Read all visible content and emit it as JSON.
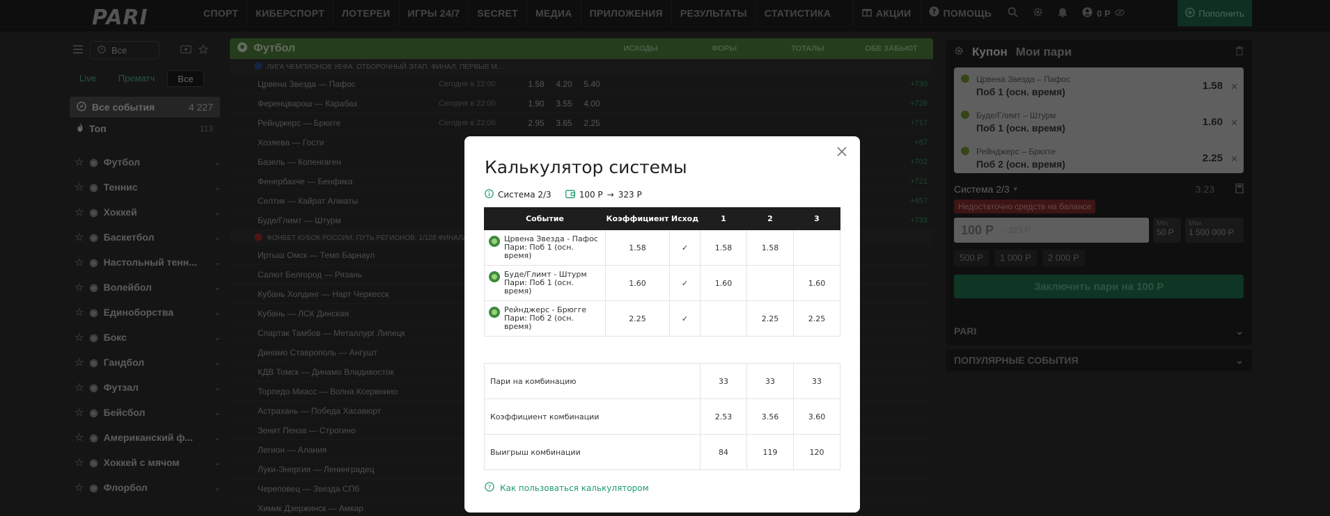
{
  "header": {
    "logo": "PARI",
    "nav": [
      "СПОРТ",
      "КИБЕРСПОРТ",
      "ЛОТЕРЕИ",
      "ИГРЫ 24/7",
      "SECRET",
      "МЕДИА",
      "ПРИЛОЖЕНИЯ",
      "РЕЗУЛЬТАТЫ",
      "СТАТИСТИКА"
    ],
    "promo": "АКЦИИ",
    "help": "ПОМОЩЬ",
    "balance": "0 Р",
    "deposit": "Пополнить"
  },
  "sidebar": {
    "filter": "Все",
    "segments": [
      "Live",
      "Прематч",
      "Все"
    ],
    "all_events": {
      "label": "Все события",
      "count": "4 227"
    },
    "top": {
      "label": "Топ",
      "count": "113"
    },
    "sports": [
      "Футбол",
      "Теннис",
      "Хоккей",
      "Баскетбол",
      "Настольный тенн...",
      "Волейбол",
      "Единоборства",
      "Бокс",
      "Гандбол",
      "Футзал",
      "Бейсбол",
      "Американский ф...",
      "Хоккей с мячом",
      "Флорбол"
    ]
  },
  "main": {
    "sport": "Футбол",
    "groups": [
      "ИСХОДЫ",
      "ФОРЫ",
      "ТОТАЛЫ",
      "ОБЕ ЗАБЬЮТ"
    ],
    "league1": "ЛИГА ЧЕМПИОНОВ УЕФА. ОТБОРОЧНЫЙ ЭТАП. ФИНАЛ. ПЕРВЫЕ М...",
    "rows1": [
      {
        "teams": "Црвена Звезда — Пафос",
        "date": "Сегодня в 22:00",
        "o1": "1.58",
        "ox": "4.20",
        "o2": "5.40",
        "more": "+730"
      },
      {
        "teams": "Ференцварош — Карабах",
        "date": "Сегодня в 22:00",
        "o1": "1.90",
        "ox": "3.55",
        "o2": "4.00",
        "more": "+726"
      },
      {
        "teams": "Рейнджерс — Брюгге",
        "date": "Сегодня в 22:00",
        "o1": "2.95",
        "ox": "3.65",
        "o2": "2.25",
        "more": "+717"
      },
      {
        "teams": "Хозяева — Гости",
        "date": "",
        "o1": "",
        "ox": "",
        "o2": "",
        "more": "+87"
      },
      {
        "teams": "Базель — Копенгаген",
        "date": "",
        "o1": "",
        "ox": "",
        "o2": "",
        "more": "+702"
      },
      {
        "teams": "Фенербахче — Бенфика",
        "date": "",
        "o1": "",
        "ox": "",
        "o2": "",
        "more": "+721"
      },
      {
        "teams": "Селтик — Кайрат Алматы",
        "date": "",
        "o1": "",
        "ox": "",
        "o2": "",
        "more": "+657"
      },
      {
        "teams": "Буде/Глимт — Штурм",
        "date": "",
        "o1": "",
        "ox": "",
        "o2": "",
        "more": "+733"
      }
    ],
    "league2": "ФОНБЕТ КУБОК РОССИИ. ПУТЬ РЕГИОНОВ. 1/128 ФИНАЛА",
    "rows2": [
      "Иртыш Омск — Темп Барнаул",
      "Салют Белгород — Рязань",
      "Кубань Холдинг — Нарт Черкесск",
      "Кубань — ЛСК Динская",
      "Спартак Тамбов — Металлург Липецк",
      "Динамо Ставрополь — Ангушт",
      "КДВ Томск — Динамо Владивосток",
      "Торпедо Миасс — Волна Ксервнино",
      "Астрахань — Победа Хасавюрт",
      "Зенит Пенза — Строгино",
      "Легион — Алания",
      "Луки-Энергия — Ленинградец",
      "Череповец — Звезда СПб",
      "Химик Дзержинск — Амкар"
    ]
  },
  "coupon": {
    "title": "Купон",
    "my": "Мои пари",
    "bets": [
      {
        "teams": "Црвена Звезда – Пафос",
        "outcome": "Поб 1 (осн. время)",
        "odd": "1.58"
      },
      {
        "teams": "Буде/Глимт – Штурм",
        "outcome": "Поб 1 (осн. время)",
        "odd": "1.60"
      },
      {
        "teams": "Рейнджерс – Брюгге",
        "outcome": "Поб 2 (осн. время)",
        "odd": "2.25"
      }
    ],
    "system": "Система 2/3",
    "coef": "3.23",
    "warning": "Недостаточно средств на балансе",
    "amount": "100 Р",
    "amount_to": "→ 323 Р",
    "min_label": "Min",
    "min_value": "50 Р",
    "max_label": "Max",
    "max_value": "1 500 000 Р",
    "quick": [
      "500 Р",
      "1 000 Р",
      "2 000 Р"
    ],
    "submit": "Заключить пари на 100 Р",
    "acc1": "PARI",
    "acc2": "ПОПУЛЯРНЫЕ СОБЫТИЯ"
  },
  "modal": {
    "title": "Калькулятор системы",
    "system": "Система 2/3",
    "stake": "100 Р",
    "arrow": "→",
    "payout": "323 Р",
    "headers": [
      "Событие",
      "Коэффициент",
      "Исход",
      "1",
      "2",
      "3"
    ],
    "events": [
      {
        "name": "Црвена Звезда - Пафос Пари: Поб 1 (осн. время)",
        "coef": "1.58",
        "check": "✓",
        "c1": "1.58",
        "c2": "1.58",
        "c3": ""
      },
      {
        "name": "Буде/Глимт - Штурм Пари: Поб 1 (осн. время)",
        "coef": "1.60",
        "check": "✓",
        "c1": "1.60",
        "c2": "",
        "c3": "1.60"
      },
      {
        "name": "Рейнджерс - Брюгге Пари: Поб 2 (осн. время)",
        "coef": "2.25",
        "check": "✓",
        "c1": "",
        "c2": "2.25",
        "c3": "2.25"
      }
    ],
    "combos": [
      {
        "label": "Пари на комбинацию",
        "v1": "33",
        "v2": "33",
        "v3": "33"
      },
      {
        "label": "Коэффициент комбинации",
        "v1": "2.53",
        "v2": "3.56",
        "v3": "3.60"
      },
      {
        "label": "Выигрыш комбинации",
        "v1": "84",
        "v2": "119",
        "v3": "120"
      }
    ],
    "help": "Как пользоваться калькулятором"
  }
}
